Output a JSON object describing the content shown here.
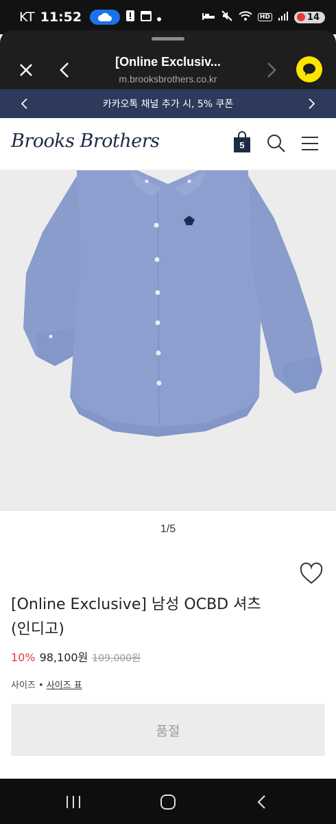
{
  "status_bar": {
    "carrier": "KT",
    "time": "11:52",
    "battery": "14"
  },
  "browser": {
    "title": "[Online Exclusiv...",
    "url": "m.brooksbrothers.co.kr"
  },
  "promo": {
    "text": "카카오톡 채널 추가 시, 5% 쿠폰"
  },
  "header": {
    "brand": "Brooks Brothers",
    "cart_count": "5"
  },
  "gallery": {
    "counter": "1/5"
  },
  "product": {
    "name": "[Online Exclusive] 남성 OCBD 셔츠 (인디고)",
    "discount": "10%",
    "sale_price": "98,100원",
    "original_price": "109,000원",
    "size_label": "사이즈 •",
    "size_chart_label": "사이즈 표",
    "soldout_label": "품절"
  },
  "colors": {
    "banner": "#2d3a5c",
    "discount": "#e53935",
    "shirt": "#8d9fcf",
    "kakao": "#fee500"
  },
  "icons": [
    "close-icon",
    "back-icon",
    "forward-icon",
    "kakao-icon",
    "cart-icon",
    "search-icon",
    "menu-icon",
    "heart-icon",
    "recents-icon",
    "home-icon"
  ]
}
